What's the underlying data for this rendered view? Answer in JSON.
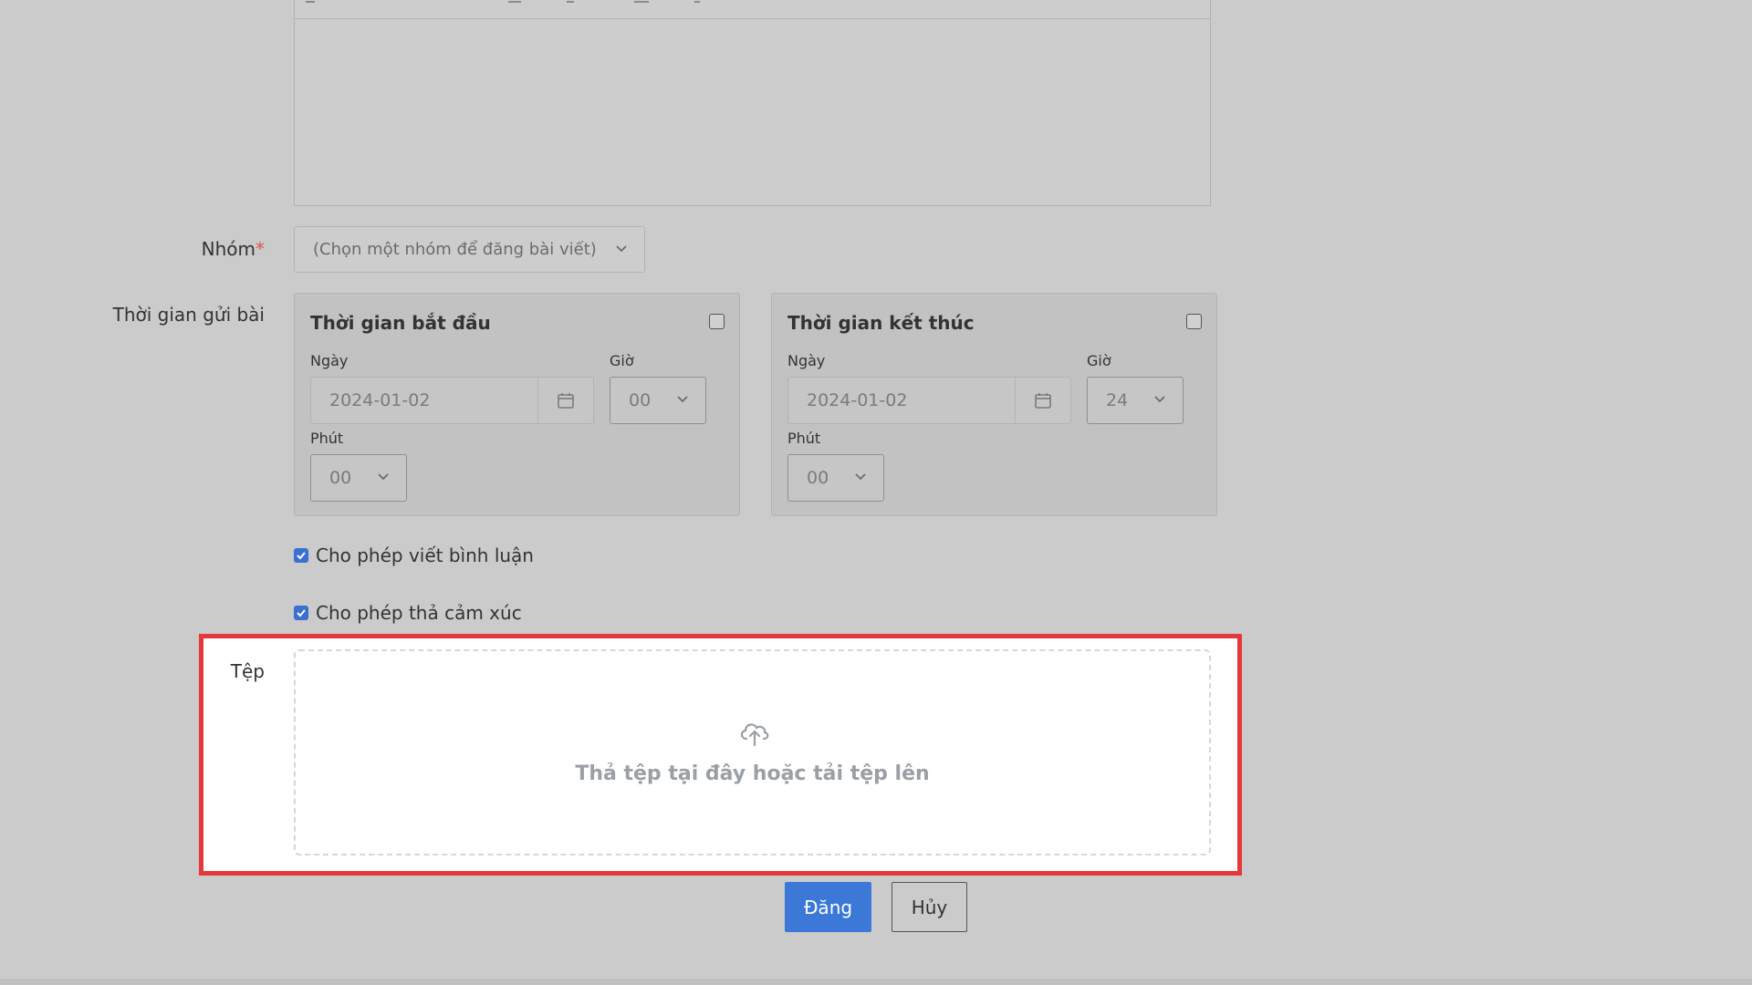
{
  "group": {
    "label": "Nhóm",
    "required_mark": "*",
    "placeholder": "(Chọn một nhóm để đăng bài viết)"
  },
  "schedule": {
    "label": "Thời gian gửi bài",
    "start": {
      "title": "Thời gian bắt đầu",
      "date_label": "Ngày",
      "date_value": "2024-01-02",
      "hour_label": "Giờ",
      "hour_value": "00",
      "minute_label": "Phút",
      "minute_value": "00"
    },
    "end": {
      "title": "Thời gian kết thúc",
      "date_label": "Ngày",
      "date_value": "2024-01-02",
      "hour_label": "Giờ",
      "hour_value": "24",
      "minute_label": "Phút",
      "minute_value": "00"
    }
  },
  "options": {
    "allow_comments": "Cho phép viết bình luận",
    "allow_reactions": "Cho phép thả cảm xúc"
  },
  "file": {
    "label": "Tệp",
    "dropzone_text": "Thả tệp tại đây hoặc tải tệp lên",
    "icon": "cloud-upload-icon"
  },
  "actions": {
    "submit_label": "Đăng",
    "cancel_label": "Hủy"
  },
  "colors": {
    "primary": "#3b78d8",
    "highlight": "#e5383b",
    "overlay": "#cbcbcb"
  }
}
